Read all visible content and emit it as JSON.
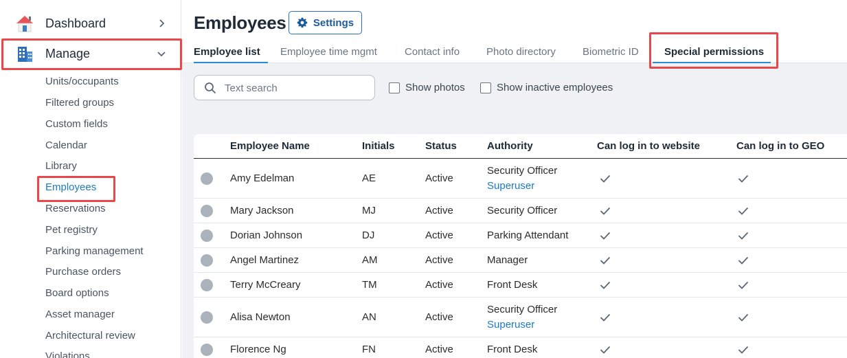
{
  "sidebar": {
    "dashboard": "Dashboard",
    "manage": "Manage",
    "items": [
      "Units/occupants",
      "Filtered groups",
      "Custom fields",
      "Calendar",
      "Library",
      "Employees",
      "Reservations",
      "Pet registry",
      "Parking management",
      "Purchase orders",
      "Board options",
      "Asset manager",
      "Architectural review",
      "Violations"
    ],
    "active_item": "Employees"
  },
  "header": {
    "title": "Employees",
    "settings_label": "Settings"
  },
  "tabs": [
    "Employee list",
    "Employee time mgmt",
    "Contact info",
    "Photo directory",
    "Biometric ID",
    "Special permissions"
  ],
  "toolbar": {
    "search_placeholder": "Text search",
    "show_photos": "Show photos",
    "show_inactive": "Show inactive employees"
  },
  "table": {
    "columns": [
      "Employee Name",
      "Initials",
      "Status",
      "Authority",
      "Can log in to website",
      "Can log in to GEO"
    ],
    "rows": [
      {
        "name": "Amy Edelman",
        "initials": "AE",
        "status": "Active",
        "authority": "Security Officer",
        "sub": "Superuser",
        "website": true,
        "geo": true
      },
      {
        "name": "Mary Jackson",
        "initials": "MJ",
        "status": "Active",
        "authority": "Security Officer",
        "sub": "",
        "website": true,
        "geo": true
      },
      {
        "name": "Dorian Johnson",
        "initials": "DJ",
        "status": "Active",
        "authority": "Parking Attendant",
        "sub": "",
        "website": true,
        "geo": true
      },
      {
        "name": "Angel Martinez",
        "initials": "AM",
        "status": "Active",
        "authority": "Manager",
        "sub": "",
        "website": true,
        "geo": true
      },
      {
        "name": "Terry McCreary",
        "initials": "TM",
        "status": "Active",
        "authority": "Front Desk",
        "sub": "",
        "website": true,
        "geo": true
      },
      {
        "name": "Alisa Newton",
        "initials": "AN",
        "status": "Active",
        "authority": "Security Officer",
        "sub": "Superuser",
        "website": true,
        "geo": true
      },
      {
        "name": "Florence Ng",
        "initials": "FN",
        "status": "Active",
        "authority": "Front Desk",
        "sub": "",
        "website": true,
        "geo": true
      }
    ]
  },
  "colors": {
    "accent": "#2b8ad6",
    "highlight": "#e8474c",
    "link": "#1a7bc4"
  }
}
